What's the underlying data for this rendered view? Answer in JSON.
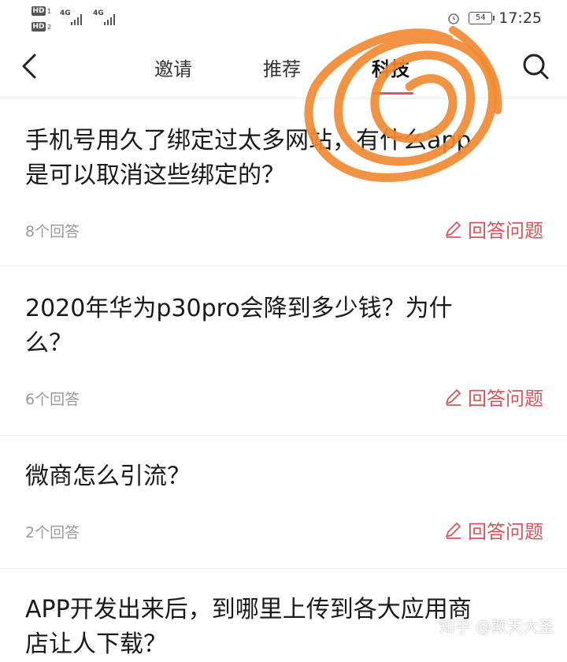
{
  "status_bar": {
    "hd1": "HD",
    "hd1_sub": "1",
    "hd2": "HD",
    "hd2_sub": "2",
    "net1": "4G",
    "net2": "4G",
    "battery": "54",
    "time": "17:25"
  },
  "nav": {
    "tabs": [
      {
        "label": "邀请"
      },
      {
        "label": "推荐"
      },
      {
        "label": "科技"
      }
    ],
    "active_tab": "科技"
  },
  "questions": [
    {
      "title_line1": "手机号用久了绑定过太多网站，有什么app",
      "title_line2": "是可以取消这些绑定的？",
      "count": "8个回答",
      "action": "回答问题"
    },
    {
      "title_line1": "2020年华为p30pro会降到多少钱？为什",
      "title_line2": "么？",
      "count": "6个回答",
      "action": "回答问题"
    },
    {
      "title_line1": "微商怎么引流？",
      "title_line2": "",
      "count": "2个回答",
      "action": "回答问题"
    },
    {
      "title_line1": "APP开发出来后，到哪里上传到各大应用商",
      "title_line2": "店让人下载？",
      "count": "",
      "action": ""
    }
  ],
  "watermark": "知乎 @欺天大圣",
  "colors": {
    "accent": "#d9535c",
    "annotation": "#f08a32",
    "muted_text": "#999999"
  }
}
